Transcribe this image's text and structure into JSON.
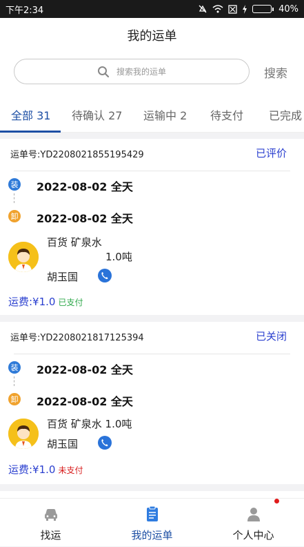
{
  "status_bar": {
    "time": "下午2:34",
    "battery": "40%"
  },
  "header": {
    "title": "我的运单"
  },
  "search": {
    "placeholder": "搜索我的运单",
    "button": "搜索"
  },
  "tabs": [
    {
      "label": "全部 31",
      "active": true
    },
    {
      "label": "待确认 27",
      "active": false
    },
    {
      "label": "运输中 2",
      "active": false
    },
    {
      "label": "待支付",
      "active": false
    },
    {
      "label": "已完成",
      "active": false
    }
  ],
  "orders": [
    {
      "order_no": "运单号:YD2208021855195429",
      "status": "已评价",
      "load_badge": "装",
      "load_date": "2022-08-02 全天",
      "unload_badge": "卸",
      "unload_date": "2022-08-02 全天",
      "goods": "百货  矿泉水",
      "weight": "1.0吨",
      "driver": "胡玉国",
      "fee": "运费:¥1.0",
      "pay_status": "已支付"
    },
    {
      "order_no": "运单号:YD2208021817125394",
      "status": "已关闭",
      "load_badge": "装",
      "load_date": "2022-08-02 全天",
      "unload_badge": "卸",
      "unload_date": "2022-08-02 全天",
      "goods": "百货  矿泉水 1.0吨",
      "weight": "",
      "driver": "胡玉国",
      "fee": "运费:¥1.0",
      "pay_status": "未支付"
    }
  ],
  "bottom_nav": [
    {
      "label": "找运",
      "icon": "truck-icon",
      "active": false
    },
    {
      "label": "我的运单",
      "icon": "waybill-icon",
      "active": true
    },
    {
      "label": "个人中心",
      "icon": "person-icon",
      "active": false,
      "has_notification": true
    }
  ],
  "colors": {
    "accent": "#1d4fa4",
    "link": "#2a3fcf",
    "paid": "#2ea84a",
    "unpaid": "#d81e1e",
    "load": "#2e7ad8",
    "unload": "#f0a22d"
  }
}
